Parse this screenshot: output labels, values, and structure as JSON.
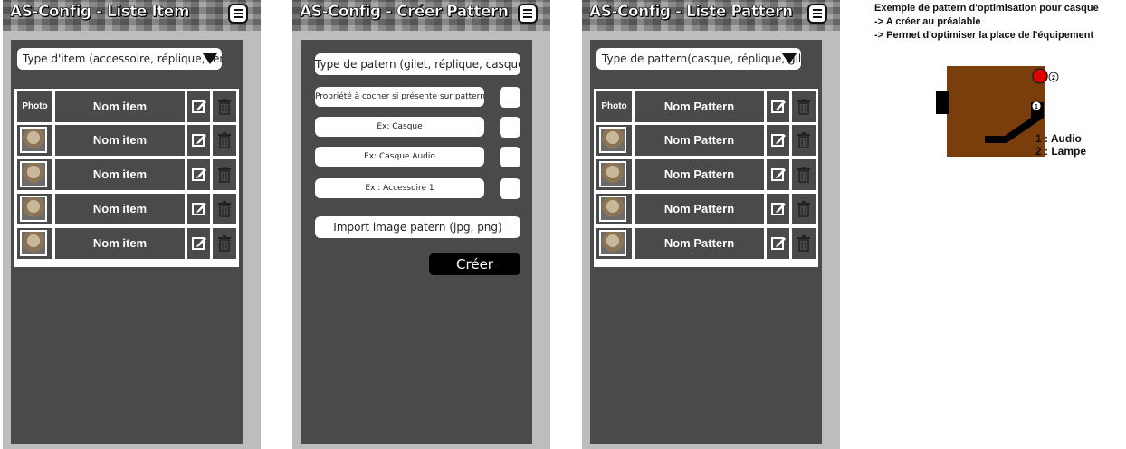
{
  "screen1": {
    "title": "AS-Config - Liste Item",
    "select": "Type d'item (accessoire, réplique, tenue ..)",
    "photo_header": "Photo",
    "col_header": "Nom item",
    "rows": [
      "Nom item",
      "Nom item",
      "Nom item",
      "Nom item"
    ]
  },
  "screen2": {
    "title": "AS-Config - Créer Pattern",
    "type_field": "Type de patern (gilet, réplique, casque)",
    "props": [
      "Propriété à cocher si présente sur pattern",
      "Ex: Casque",
      "Ex: Casque Audio",
      "Ex : Accessoire 1"
    ],
    "import": "Import image patern (jpg, png)",
    "create": "Créer"
  },
  "screen3": {
    "title": "AS-Config - Liste Pattern",
    "select": "Type de pattern(casque, réplique, gilet)",
    "photo_header": "Photo",
    "col_header": "Nom Pattern",
    "rows": [
      "Nom Pattern",
      "Nom Pattern",
      "Nom Pattern",
      "Nom Pattern"
    ]
  },
  "notes": {
    "line1": "Exemple de pattern d'optimisation pour casque",
    "line2": "-> A créer au préalable",
    "line3": "-> Permet d'optimiser la place de l'équipement",
    "marker1": "1",
    "marker2": "2",
    "legend1": "1 : Audio",
    "legend2": "2 : Lampe"
  },
  "colors": {
    "panel": "#4a4a4a",
    "frame": "#bdbdbd",
    "pattern_brown": "#7a3e0c",
    "lamp_red": "#e00000"
  }
}
